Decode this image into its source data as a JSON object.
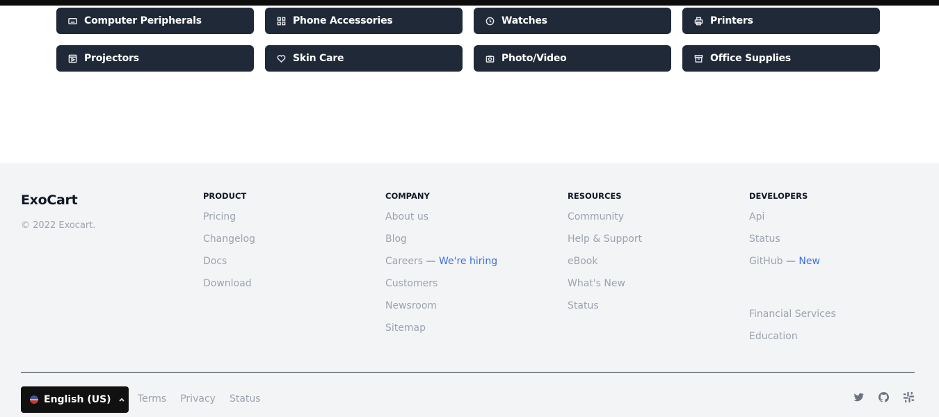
{
  "categories": [
    {
      "label": "Computer Peripherals",
      "icon": "keyboard-icon"
    },
    {
      "label": "Phone Accessories",
      "icon": "grid-icon"
    },
    {
      "label": "Watches",
      "icon": "clock-icon"
    },
    {
      "label": "Printers",
      "icon": "printer-icon"
    },
    {
      "label": "Projectors",
      "icon": "projector-icon"
    },
    {
      "label": "Skin Care",
      "icon": "heart-icon"
    },
    {
      "label": "Photo/Video",
      "icon": "camera-icon"
    },
    {
      "label": "Office Supplies",
      "icon": "archive-icon"
    }
  ],
  "footer": {
    "brand": "ExoCart",
    "copyright": "© 2022 Exocart.",
    "product": {
      "heading": "PRODUCT",
      "links": [
        "Pricing",
        "Changelog",
        "Docs",
        "Download"
      ]
    },
    "company": {
      "heading": "COMPANY",
      "links": [
        "About us",
        "Blog",
        "Careers",
        "Customers",
        "Newsroom",
        "Sitemap"
      ],
      "careers_highlight": " — We're hiring"
    },
    "resources": {
      "heading": "RESOURCES",
      "links": [
        "Community",
        "Help & Support",
        "eBook",
        "What's New",
        "Status"
      ]
    },
    "developers": {
      "heading": "DEVELOPERS",
      "links": [
        "Api",
        "Status",
        "GitHub"
      ],
      "github_highlight": " — New",
      "extra_links": [
        "Financial Services",
        "Education"
      ]
    },
    "language": "English (US)",
    "bottom_links": [
      "Terms",
      "Privacy",
      "Status"
    ],
    "social": [
      "twitter-icon",
      "github-icon",
      "slack-icon"
    ]
  },
  "colors": {
    "button_bg": "#1f2937",
    "footer_bg": "#f3f4f6",
    "link_gray": "#9ca3af",
    "highlight_blue": "#3b6fe0"
  }
}
